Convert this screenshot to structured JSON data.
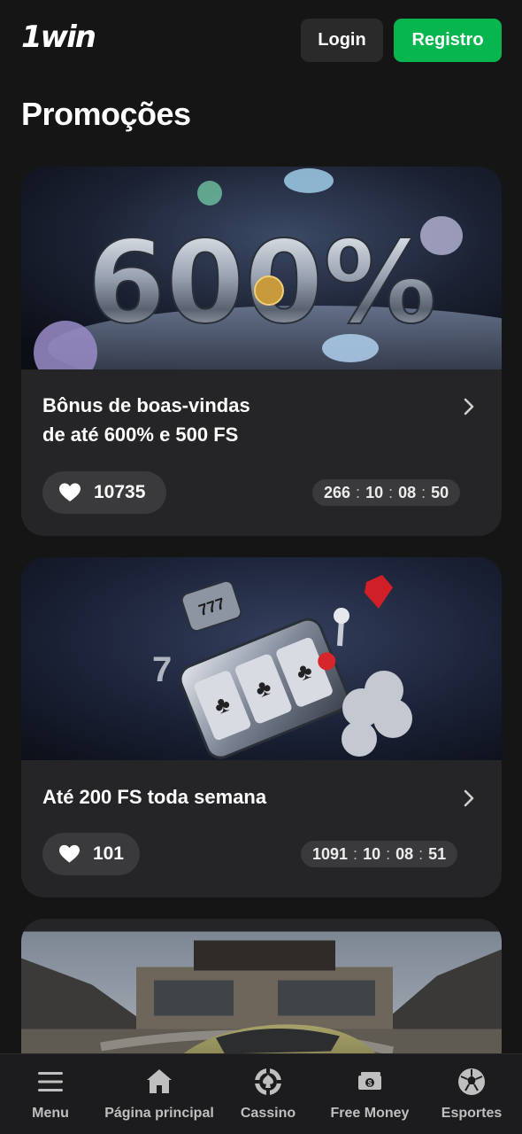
{
  "header": {
    "logo": "1win",
    "login_label": "Login",
    "register_label": "Registro"
  },
  "page_title": "Promoções",
  "promos": [
    {
      "title_lines": [
        "Bônus de boas-vindas",
        "de até 600% e 500 FS"
      ],
      "likes": "10735",
      "timer": [
        "266",
        "10",
        "08",
        "50"
      ],
      "banner_text": "600%"
    },
    {
      "title_lines": [
        "Até 200 FS toda semana"
      ],
      "likes": "101",
      "timer": [
        "1091",
        "10",
        "08",
        "51"
      ]
    },
    {
      "title_lines": []
    }
  ],
  "bottom_nav": [
    {
      "label": "Menu",
      "icon": "menu-icon"
    },
    {
      "label": "Página principal",
      "icon": "home-icon"
    },
    {
      "label": "Cassino",
      "icon": "casino-chip-icon"
    },
    {
      "label": "Free Money",
      "icon": "money-icon"
    },
    {
      "label": "Esportes",
      "icon": "soccer-ball-icon"
    }
  ],
  "colors": {
    "background": "#151515",
    "card": "#252527",
    "accent_green": "#08b64f",
    "login_button": "#2a2a2b"
  }
}
